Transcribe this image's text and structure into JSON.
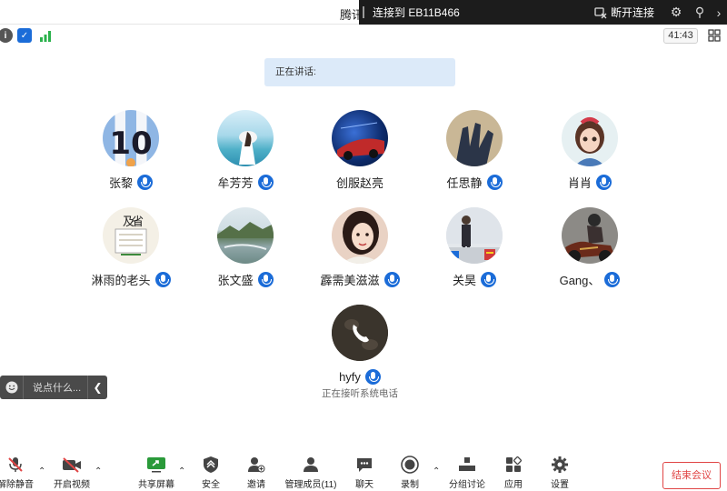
{
  "app": {
    "title": "腾讯"
  },
  "remote": {
    "connected_to": "连接到 EB11B466",
    "disconnect_label": "断开连接"
  },
  "timer": "41:43",
  "speaking": {
    "label": "正在讲话:"
  },
  "participants": [
    {
      "name": "张黎",
      "avatar": "soccer-jersey-10",
      "mic": true
    },
    {
      "name": "牟芳芳",
      "avatar": "seaside-girl",
      "mic": true
    },
    {
      "name": "创服赵亮",
      "avatar": "blue-night-car",
      "mic": false
    },
    {
      "name": "任思静",
      "avatar": "shadow-hand",
      "mic": true
    },
    {
      "name": "肖肖",
      "avatar": "cartoon-girl",
      "mic": true
    },
    {
      "name": "淋雨的老头",
      "avatar": "calligraphy-book",
      "mic": true
    },
    {
      "name": "张文盛",
      "avatar": "lake-landscape",
      "mic": true
    },
    {
      "name": "霹需美滋滋",
      "avatar": "woman-selfie",
      "mic": true
    },
    {
      "name": "关昊",
      "avatar": "man-standing",
      "mic": true
    },
    {
      "name": "Gang、",
      "avatar": "motorcycle-rider",
      "mic": true
    },
    {
      "name": "hyfy",
      "avatar": "phone-call",
      "mic": true,
      "sub": "正在接听系统电话"
    }
  ],
  "chat": {
    "placeholder": "说点什么..."
  },
  "toolbar": {
    "unmute": "解除静音",
    "start_video": "开启视频",
    "share_screen": "共享屏幕",
    "security": "安全",
    "invite": "邀请",
    "manage_members": "管理成员(11)",
    "chat": "聊天",
    "record": "录制",
    "breakout": "分组讨论",
    "apps": "应用",
    "settings": "设置",
    "end_meeting": "结束会议"
  },
  "colors": {
    "accent": "#1b6cd8",
    "danger": "#e04545",
    "speaking_bg": "#dceaf9"
  }
}
